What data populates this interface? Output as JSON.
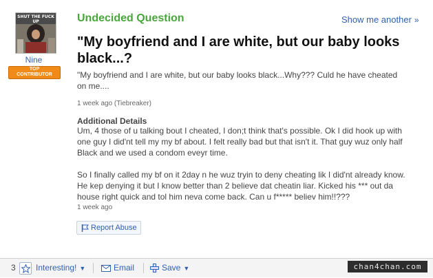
{
  "user": {
    "avatar_caption": "SHUT THE FUCK UP",
    "name": "Nine",
    "badge": [
      "TOP",
      "CONTRIBUTOR"
    ]
  },
  "question": {
    "type_label": "Undecided Question",
    "show_another": "Show me another",
    "title": "\"My boyfriend and I are white, but our baby looks black...?",
    "body": "\"My boyfriend and I are white, but our baby looks black...Why??? Culd he have cheated on me....",
    "meta": "1 week ago (Tiebreaker)"
  },
  "details": {
    "title": "Additional Details",
    "paragraph1": "Um, 4 those of u talking bout I cheated, I don;t think that's possible. Ok I did hook up with one guy I did'nt tell my my bf about. I felt really bad but that isn't it. That guy wuz only half Black and we used a condom eveyr time.",
    "paragraph2": "So I finally called my bf on it 2day n he wuz tryin to deny cheating lik I did'nt already know. He kep denying it but I know better than 2 believe dat cheatin liar. Kicked his *** out da house right quick and tol him neva come back. Can u f***** believ him!!???",
    "meta": "1 week ago"
  },
  "actions": {
    "report_abuse": "Report Abuse",
    "interesting_count": "3",
    "interesting": "Interesting!",
    "email": "Email",
    "save": "Save"
  },
  "watermark": "chan4chan.com",
  "colors": {
    "green_heading": "#4aa53c",
    "link_blue": "#2f5fb3",
    "badge_orange": "#f08a19"
  }
}
